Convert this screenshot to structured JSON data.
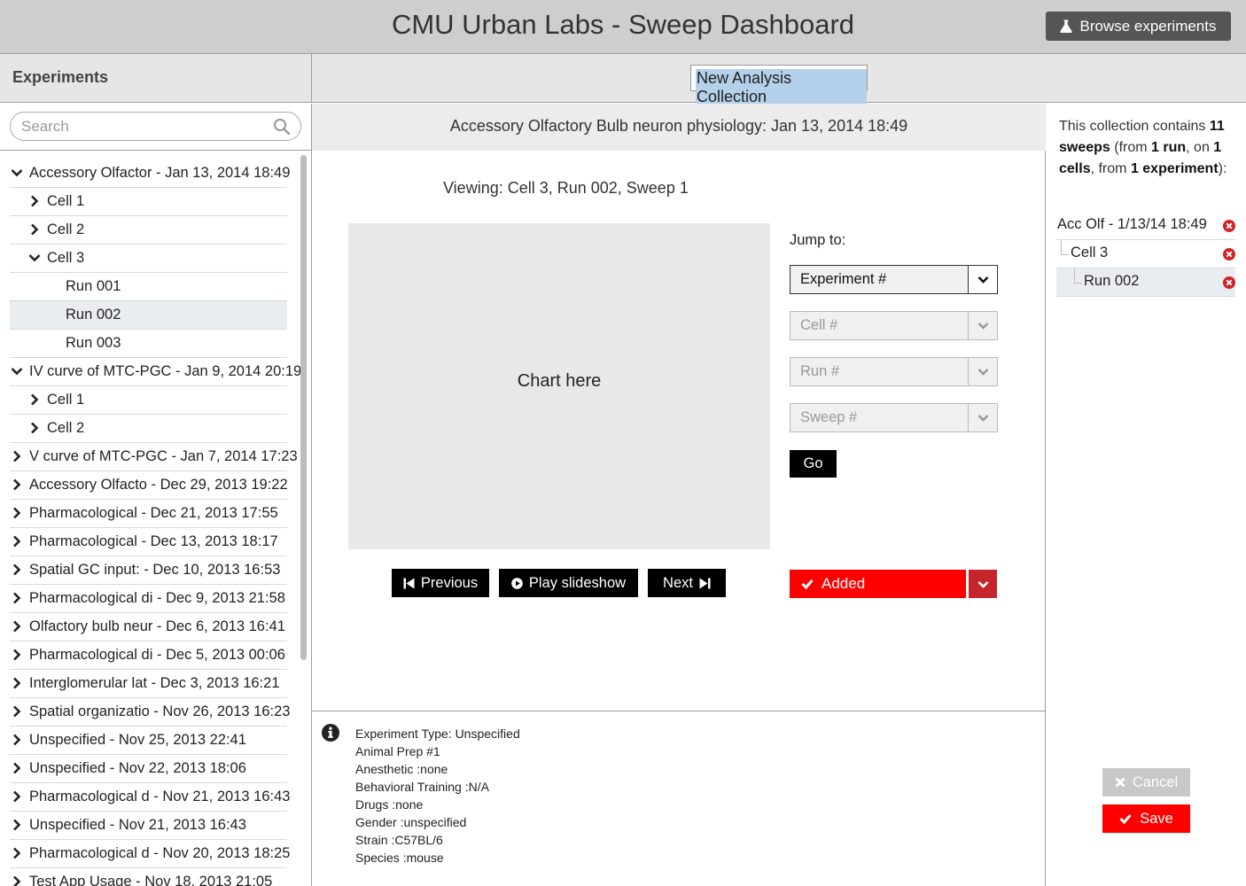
{
  "header": {
    "title": "CMU Urban Labs - Sweep Dashboard",
    "browse_label": "Browse experiments",
    "browse_icon": "flask-icon"
  },
  "sidebar": {
    "title": "Experiments",
    "search_placeholder": "Search",
    "search_value": "",
    "tree": [
      {
        "label": "Accessory Olfactor - Jan 13, 2014 18:49",
        "level": 0,
        "expanded": true
      },
      {
        "label": "Cell 1",
        "level": 1,
        "expanded": false
      },
      {
        "label": "Cell 2",
        "level": 1,
        "expanded": false
      },
      {
        "label": "Cell 3",
        "level": 1,
        "expanded": true
      },
      {
        "label": "Run 001",
        "level": 2
      },
      {
        "label": "Run 002",
        "level": 2,
        "selected": true
      },
      {
        "label": "Run 003",
        "level": 2
      },
      {
        "label": "IV curve of MTC-PGC - Jan 9, 2014 20:19",
        "level": 0,
        "expanded": true
      },
      {
        "label": "Cell 1",
        "level": 1,
        "expanded": false
      },
      {
        "label": "Cell 2",
        "level": 1,
        "expanded": false
      },
      {
        "label": "V curve of MTC-PGC - Jan 7, 2014 17:23",
        "level": 0,
        "expanded": false
      },
      {
        "label": "Accessory Olfacto - Dec 29, 2013 19:22",
        "level": 0,
        "expanded": false
      },
      {
        "label": "Pharmacological  - Dec 21, 2013 17:55",
        "level": 0,
        "expanded": false
      },
      {
        "label": "Pharmacological  - Dec 13, 2013 18:17",
        "level": 0,
        "expanded": false
      },
      {
        "label": "Spatial GC input: - Dec 10, 2013 16:53",
        "level": 0,
        "expanded": false
      },
      {
        "label": "Pharmacological di - Dec 9, 2013 21:58",
        "level": 0,
        "expanded": false
      },
      {
        "label": "Olfactory bulb neur - Dec 6, 2013 16:41",
        "level": 0,
        "expanded": false
      },
      {
        "label": "Pharmacological di - Dec 5, 2013 00:06",
        "level": 0,
        "expanded": false
      },
      {
        "label": "Interglomerular lat -  Dec 3, 2013 16:21",
        "level": 0,
        "expanded": false
      },
      {
        "label": "Spatial organizatio - Nov 26, 2013 16:23",
        "level": 0,
        "expanded": false
      },
      {
        "label": "Unspecified - Nov 25, 2013 22:41",
        "level": 0,
        "expanded": false
      },
      {
        "label": "Unspecified - Nov 22, 2013 18:06",
        "level": 0,
        "expanded": false
      },
      {
        "label": "Pharmacological d - Nov 21, 2013 16:43",
        "level": 0,
        "expanded": false
      },
      {
        "label": "Unspecified - Nov 21, 2013 16:43",
        "level": 0,
        "expanded": false
      },
      {
        "label": "Pharmacological d - Nov 20, 2013 18:25",
        "level": 0,
        "expanded": false
      },
      {
        "label": "Test App Usage - Nov 18, 2013 21:05",
        "level": 0,
        "expanded": false
      }
    ]
  },
  "topbar": {
    "collection_name": "New Analysis Collection"
  },
  "main": {
    "heading": "Accessory Olfactory Bulb neuron physiology: Jan 13, 2014 18:49",
    "viewing": "Viewing: Cell 3, Run 002, Sweep 1",
    "chart_placeholder": "Chart here",
    "prev_label": "Previous",
    "play_label": "Play slideshow",
    "next_label": "Next",
    "jump_label": "Jump to:",
    "dropdowns": {
      "experiment": "Experiment #",
      "cell": "Cell #",
      "run": "Run #",
      "sweep": "Sweep #"
    },
    "go_label": "Go",
    "added_label": "Added",
    "accent_red": "#ff0000",
    "accent_dark_red": "#c6262b"
  },
  "info": {
    "lines": [
      "Experiment Type: Unspecified",
      "Animal Prep #1",
      "Anesthetic :none",
      "Behavioral Training :N/A",
      "Drugs :none",
      "Gender :unspecified",
      "Strain :C57BL/6",
      "Species :mouse"
    ]
  },
  "collection": {
    "summary_prefix": "This collection contains ",
    "sweeps": "11 sweeps",
    "from_open": " (from ",
    "runs": "1 run",
    "on_text": ", on ",
    "cells": "1 cells",
    "from_text": ", from ",
    "experiments": "1 experiment",
    "summary_suffix": "):",
    "items": [
      {
        "label": "Acc Olf - 1/13/14 18:49",
        "level": 0
      },
      {
        "label": "Cell 3",
        "level": 1
      },
      {
        "label": "Run 002",
        "level": 2,
        "selected": true
      }
    ],
    "cancel_label": "Cancel",
    "save_label": "Save"
  }
}
